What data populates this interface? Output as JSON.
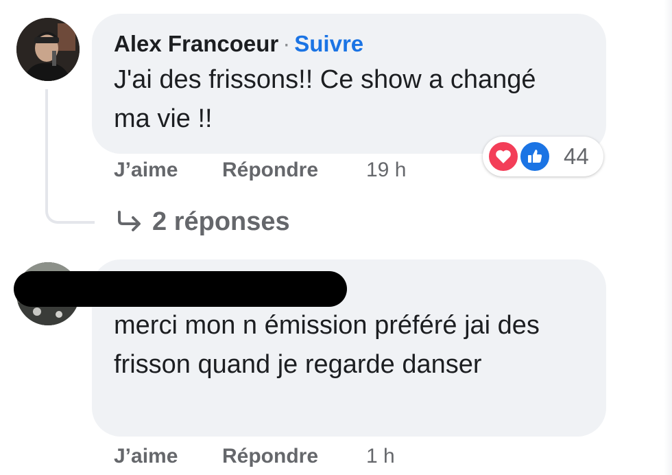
{
  "comments": [
    {
      "author": "Alex Francoeur",
      "separator": "·",
      "follow_label": "Suivre",
      "text": "J'ai des frissons!! Ce show a changé ma vie !!",
      "actions": {
        "like_label": "J’aime",
        "reply_label": "Répondre",
        "time": "19 h"
      },
      "reactions": {
        "icons": [
          "heart-icon",
          "thumbs-up-icon"
        ],
        "count": "44"
      },
      "replies_label": "2 réponses"
    },
    {
      "author_redacted": true,
      "text": "merci mon n émission préféré jai des frisson quand je regarde danser",
      "actions": {
        "like_label": "J’aime",
        "reply_label": "Répondre",
        "time": "1 h"
      }
    }
  ],
  "colors": {
    "bubble": "#f0f2f5",
    "text": "#1c1e21",
    "secondary": "#65676b",
    "link_blue": "#1b74e4",
    "love_red": "#f33e58",
    "like_blue": "#1b74e4"
  }
}
